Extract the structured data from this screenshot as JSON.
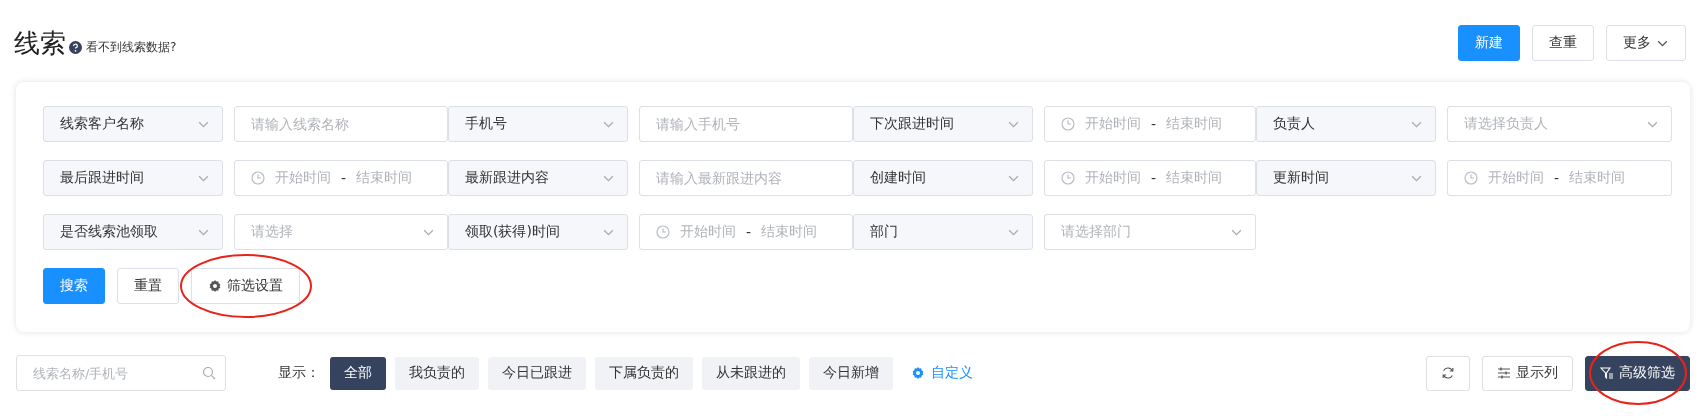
{
  "header": {
    "title": "线索",
    "help_text": "看不到线索数据?",
    "actions": [
      {
        "label": "新建",
        "kind": "primary"
      },
      {
        "label": "查重",
        "kind": "default"
      },
      {
        "label": "更多",
        "kind": "dropdown"
      }
    ]
  },
  "filters": [
    {
      "field": "线索客户名称",
      "kind": "text",
      "placeholder": "请输入线索名称"
    },
    {
      "field": "手机号",
      "kind": "text",
      "placeholder": "请输入手机号"
    },
    {
      "field": "下次跟进时间",
      "kind": "daterange",
      "start_placeholder": "开始时间",
      "separator": "-",
      "end_placeholder": "结束时间"
    },
    {
      "field": "负责人",
      "kind": "select",
      "placeholder": "请选择负责人"
    },
    {
      "field": "最后跟进时间",
      "kind": "daterange",
      "start_placeholder": "开始时间",
      "separator": "-",
      "end_placeholder": "结束时间"
    },
    {
      "field": "最新跟进内容",
      "kind": "text",
      "placeholder": "请输入最新跟进内容"
    },
    {
      "field": "创建时间",
      "kind": "daterange",
      "start_placeholder": "开始时间",
      "separator": "-",
      "end_placeholder": "结束时间"
    },
    {
      "field": "更新时间",
      "kind": "daterange",
      "start_placeholder": "开始时间",
      "separator": "-",
      "end_placeholder": "结束时间"
    },
    {
      "field": "是否线索池领取",
      "kind": "select",
      "placeholder": "请选择"
    },
    {
      "field": "领取(获得)时间",
      "kind": "daterange",
      "start_placeholder": "开始时间",
      "separator": "-",
      "end_placeholder": "结束时间"
    },
    {
      "field": "部门",
      "kind": "select",
      "placeholder": "请选择部门"
    }
  ],
  "filter_buttons": [
    {
      "label": "搜索",
      "kind": "primary",
      "circled": false
    },
    {
      "label": "重置",
      "kind": "default",
      "circled": false
    },
    {
      "label": "筛选设置",
      "kind": "settings",
      "circled": true
    }
  ],
  "toolbar": {
    "search": {
      "placeholder": "线索名称/手机号"
    },
    "show_label": "显示：",
    "views": [
      {
        "label": "全部",
        "selected": true
      },
      {
        "label": "我负责的",
        "selected": false
      },
      {
        "label": "今日已跟进",
        "selected": false
      },
      {
        "label": "下属负责的",
        "selected": false
      },
      {
        "label": "从未跟进的",
        "selected": false
      },
      {
        "label": "今日新增",
        "selected": false
      }
    ],
    "customize": "自定义",
    "right_buttons": [
      {
        "kind": "refresh",
        "circled": false
      },
      {
        "kind": "columns",
        "label": "显示列",
        "circled": false
      },
      {
        "kind": "filter",
        "label": "高级筛选",
        "circled": true
      }
    ]
  }
}
